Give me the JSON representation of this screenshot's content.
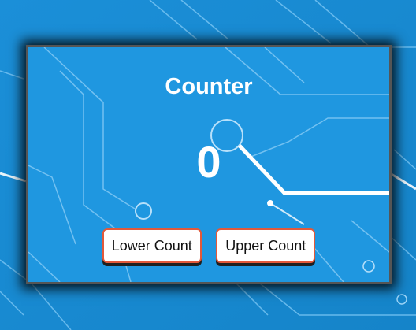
{
  "app": {
    "title": "Counter",
    "count": "0"
  },
  "buttons": {
    "lower_label": "Lower Count",
    "upper_label": "Upper Count"
  },
  "colors": {
    "background": "#1a8fd6",
    "card_background": "#1f97e0",
    "button_border": "#e2593b",
    "text": "#ffffff"
  }
}
